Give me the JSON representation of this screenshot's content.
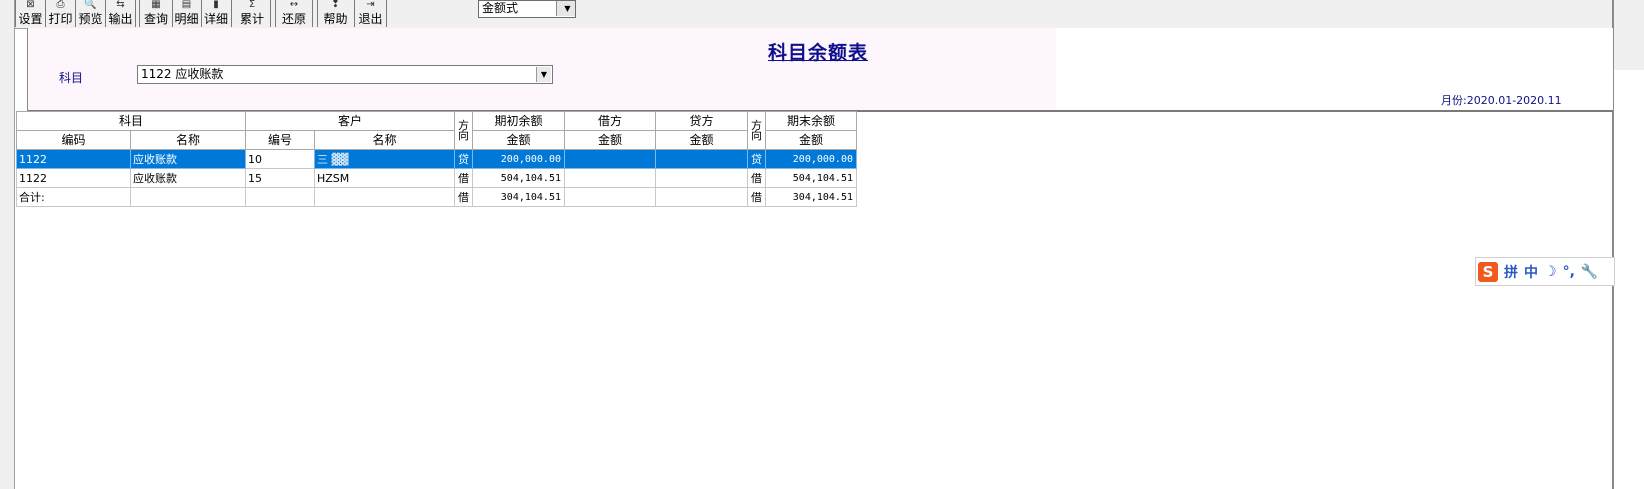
{
  "toolbar": {
    "buttons": [
      {
        "label": "设置",
        "icon": "setup-icon"
      },
      {
        "label": "打印",
        "icon": "print-icon"
      },
      {
        "label": "预览",
        "icon": "preview-icon"
      },
      {
        "label": "输出",
        "icon": "export-icon"
      },
      {
        "label": "查询",
        "icon": "query-icon"
      },
      {
        "label": "明细",
        "icon": "detail-list-icon"
      },
      {
        "label": "详细",
        "icon": "detail-icon"
      },
      {
        "label": "累计",
        "icon": "sum-icon"
      },
      {
        "label": "还原",
        "icon": "restore-icon"
      },
      {
        "label": "帮助",
        "icon": "help-icon"
      },
      {
        "label": "退出",
        "icon": "exit-icon"
      }
    ],
    "mode_value": "金额式"
  },
  "header": {
    "title": "科目余额表",
    "subject_label": "科目",
    "subject_value": "1122 应收账款",
    "period_label": "月份:",
    "period_value": "2020.01-2020.11"
  },
  "grid": {
    "group_headers": {
      "subject": "科目",
      "customer": "客户",
      "dir_top_1": "方",
      "dir_bottom_1": "向",
      "opening": "期初余额",
      "debit": "借方",
      "credit": "贷方",
      "dir_top_2": "方",
      "dir_bottom_2": "向",
      "closing": "期末余额"
    },
    "sub_headers": {
      "code": "编码",
      "name": "名称",
      "cust_no": "编号",
      "cust_name": "名称",
      "opening_amount": "金额",
      "debit_amount": "金额",
      "credit_amount": "金额",
      "closing_amount": "金额"
    },
    "rows": [
      {
        "code": "1122",
        "name": "应收账款",
        "cust_no": "10",
        "cust_name": "三 ▓▓",
        "dir1": "贷",
        "opening": "200,000.00",
        "debit": "",
        "credit": "",
        "dir2": "贷",
        "closing": "200,000.00"
      },
      {
        "code": "1122",
        "name": "应收账款",
        "cust_no": "15",
        "cust_name": "HZSM",
        "dir1": "借",
        "opening": "504,104.51",
        "debit": "",
        "credit": "",
        "dir2": "借",
        "closing": "504,104.51"
      }
    ],
    "total": {
      "label": "合计:",
      "dir1": "借",
      "opening": "304,104.51",
      "debit": "",
      "credit": "",
      "dir2": "借",
      "closing": "304,104.51"
    }
  },
  "ime": {
    "logo": "S",
    "items": [
      "拼",
      "中",
      "☽",
      "°,",
      "🔧"
    ]
  }
}
